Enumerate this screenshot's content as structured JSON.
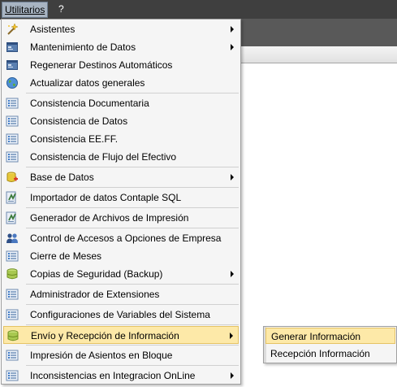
{
  "menubar": {
    "items": [
      {
        "label": "Utilitarios"
      },
      {
        "label": "?"
      }
    ]
  },
  "menu": {
    "items": [
      {
        "label": "Asistentes",
        "icon": "wand-icon",
        "submenu": true
      },
      {
        "label": "Mantenimiento de Datos",
        "icon": "form-icon",
        "submenu": true
      },
      {
        "label": "Regenerar Destinos Automáticos",
        "icon": "form-icon",
        "submenu": false
      },
      {
        "label": "Actualizar datos generales",
        "icon": "globe-icon",
        "submenu": false
      },
      {
        "label": "Consistencia Documentaria",
        "icon": "list-icon",
        "submenu": false
      },
      {
        "label": "Consistencia de Datos",
        "icon": "list-icon",
        "submenu": false
      },
      {
        "label": "Consistencia EE.FF.",
        "icon": "list-icon",
        "submenu": false
      },
      {
        "label": "Consistencia de Flujo del Efectivo",
        "icon": "list-icon",
        "submenu": false
      },
      {
        "label": "Base de Datos",
        "icon": "database-add-icon",
        "submenu": true
      },
      {
        "label": "Importador de datos Contaple SQL",
        "icon": "import-icon",
        "submenu": false
      },
      {
        "label": "Generador de Archivos de Impresión",
        "icon": "import-icon",
        "submenu": false
      },
      {
        "label": "Control de Accesos a Opciones de Empresa",
        "icon": "users-icon",
        "submenu": false
      },
      {
        "label": "Cierre de Meses",
        "icon": "list-icon",
        "submenu": false
      },
      {
        "label": "Copias de Seguridad (Backup)",
        "icon": "database-icon",
        "submenu": true
      },
      {
        "label": "Administrador de Extensiones",
        "icon": "list-icon",
        "submenu": false
      },
      {
        "label": "Configuraciones de Variables del Sistema",
        "icon": "list-icon",
        "submenu": false
      },
      {
        "label": "Envío y Recepción de Información",
        "icon": "database-icon",
        "submenu": true
      },
      {
        "label": "Impresión de Asientos en Bloque",
        "icon": "list-icon",
        "submenu": false
      },
      {
        "label": "Inconsistencias en Integracion OnLine",
        "icon": "list-icon",
        "submenu": true
      }
    ]
  },
  "submenu": {
    "items": [
      {
        "label": "Generar Información"
      },
      {
        "label": "Recepción Información"
      }
    ]
  },
  "colors": {
    "menubar_bg": "#3f3f3f",
    "highlight_bg": "#fde9a8",
    "menu_bg": "#f5f5f5"
  }
}
